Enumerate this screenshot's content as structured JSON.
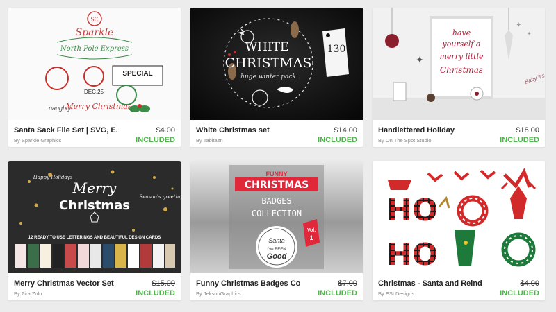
{
  "products": [
    {
      "title": "Santa Sack File Set | SVG, E...",
      "author": "By Sparkle Graphics",
      "price": "$4.00",
      "badge": "INCLUDED",
      "image": {
        "top_text": "SC",
        "brand": "Sparkle",
        "line1": "North Pole Express",
        "line2": "SPECIAL",
        "line3": "DEC.25",
        "line4": "Merry Christmas",
        "line5": "naughty"
      }
    },
    {
      "title": "White Christmas set",
      "author": "By Tabitazn",
      "price": "$14.00",
      "badge": "INCLUDED",
      "image": {
        "line1": "WHITE",
        "line2": "CHRISTMAS",
        "line3": "huge winter pack",
        "tag_number": "130"
      }
    },
    {
      "title": "Handlettered Holiday",
      "author": "By On The Spot Studio",
      "price": "$18.00",
      "badge": "INCLUDED",
      "image": {
        "line1": "have",
        "line2": "yourself a",
        "line3": "merry little",
        "line4": "Christmas",
        "line5": "Baby it's cold"
      }
    },
    {
      "title": "Merry Christmas Vector Set",
      "author": "By Zira Zulu",
      "price": "$15.00",
      "badge": "INCLUDED",
      "image": {
        "line1": "Merry",
        "line2": "Christmas",
        "line3": "Happy Holidays",
        "line4": "Season's greetings",
        "line5": "12 READY TO USE LETTERINGS AND BEAUTIFUL DESIGN CARDS"
      }
    },
    {
      "title": "Funny Christmas Badges Co...",
      "author": "By JeksonGraphics",
      "price": "$7.00",
      "badge": "INCLUDED",
      "image": {
        "line1": "FUNNY",
        "line2": "CHRISTMAS",
        "line3": "BADGES",
        "line4": "COLLECTION",
        "line5": "Santa",
        "line6": "I've BEEN",
        "line7": "Good",
        "vol": "Vol.",
        "vol_num": "1"
      }
    },
    {
      "title": "Christmas - Santa and Reind...",
      "author": "By ESI Designs",
      "price": "$4.00",
      "badge": "INCLUDED",
      "image": {
        "word": "HO"
      }
    }
  ],
  "colors": {
    "included": "#4cb648",
    "accent_red": "#d9232e"
  }
}
